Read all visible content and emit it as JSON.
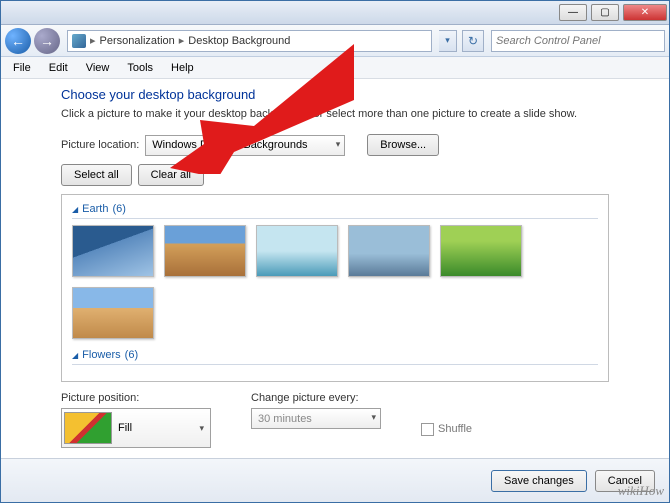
{
  "titlebar": {
    "min": "—",
    "max": "▢",
    "close": "✕"
  },
  "nav": {
    "breadcrumb": [
      "Personalization",
      "Desktop Background"
    ],
    "search_placeholder": "Search Control Panel"
  },
  "menu": [
    "File",
    "Edit",
    "View",
    "Tools",
    "Help"
  ],
  "main": {
    "heading": "Choose your desktop background",
    "subtext": "Click a picture to make it your desktop background, or select more than one picture to create a slide show.",
    "location_label": "Picture location:",
    "location_value": "Windows Desktop Backgrounds",
    "browse": "Browse...",
    "select_all": "Select all",
    "clear_all": "Clear all",
    "groups": [
      {
        "name": "Earth",
        "count": 6
      },
      {
        "name": "Flowers",
        "count": 6
      }
    ],
    "position_label": "Picture position:",
    "position_value": "Fill",
    "change_label": "Change picture every:",
    "change_value": "30 minutes",
    "shuffle": "Shuffle"
  },
  "footer": {
    "save": "Save changes",
    "cancel": "Cancel"
  },
  "watermark": "wikiHow"
}
